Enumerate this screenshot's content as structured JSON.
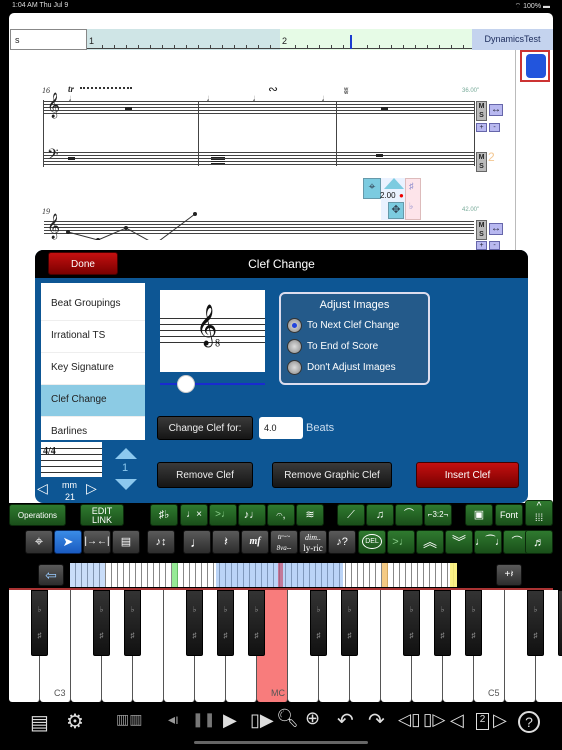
{
  "status_bar": {
    "time": "1:04 AM  Thu Jul 9",
    "battery": "100%"
  },
  "ruler": {
    "input_value": "s",
    "measure_labels": [
      "1",
      "2"
    ],
    "document_tab": "DynamicsTest"
  },
  "score": {
    "system1": {
      "measure_number": "16",
      "tempo": "36.00\"",
      "ornaments": [
        "tr",
        "~",
        "mordent"
      ]
    },
    "system2": {
      "measure_number": "19",
      "tempo": "42.00\""
    },
    "ms_label": "M S",
    "page_number": "2",
    "note_editor": {
      "duration_value": "2.00"
    }
  },
  "dialog": {
    "title": "Clef Change",
    "done_label": "Done",
    "list_items": [
      {
        "label": "Beat Groupings",
        "selected": false
      },
      {
        "label": "Irrational TS",
        "selected": false
      },
      {
        "label": "Key Signature",
        "selected": false
      },
      {
        "label": "Clef Change",
        "selected": true
      },
      {
        "label": "Barlines",
        "selected": false
      }
    ],
    "time_sig": "4/4",
    "stepper_value": "1",
    "measure_nav": {
      "label": "mm",
      "value": "21"
    },
    "preview_clef": "treble-8vb",
    "slider_value": 0.15,
    "adjust_images": {
      "title": "Adjust Images",
      "options": [
        {
          "label": "To Next Clef Change",
          "selected": true
        },
        {
          "label": "To End of Score",
          "selected": false
        },
        {
          "label": "Don't Adjust Images",
          "selected": false
        }
      ]
    },
    "change_clef_for_label": "Change Clef for:",
    "beats_value": "4.0",
    "beats_label": "Beats",
    "remove_clef_label": "Remove Clef",
    "remove_graphic_clef_label": "Remove Graphic Clef",
    "insert_clef_label": "Insert Clef"
  },
  "toolbar1": {
    "operations": "Operations",
    "edit_link": "EDIT LINK",
    "font": "Font"
  },
  "toolbar2": {
    "del": "DEL",
    "dim": "dim..",
    "lyric": "ly-ric",
    "mf": "mf"
  },
  "keyboard": {
    "labels": {
      "c3": "C3",
      "mc": "MC",
      "c5": "C5"
    },
    "flat": "♭",
    "sharp": "♯"
  },
  "bottom_bar": {
    "page_indicator": "2"
  }
}
